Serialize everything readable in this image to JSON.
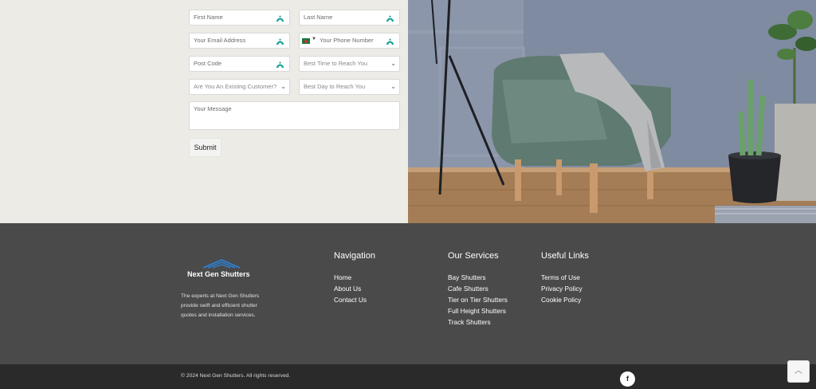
{
  "form": {
    "first_name_placeholder": "First Name",
    "last_name_placeholder": "Last Name",
    "email_placeholder": "Your Email Address",
    "phone_placeholder": "Your Phone Number",
    "postcode_placeholder": "Post Code",
    "best_time_placeholder": "Best Time to Reach You",
    "existing_customer_placeholder": "Are You An Existing Customer?",
    "best_day_placeholder": "Best Day to Reach You",
    "message_placeholder": "Your Message",
    "submit_label": "Submit"
  },
  "footer": {
    "brand_name": "Next Gen Shutters",
    "about_text": "The experts at Next Gen Shutters provide swift and efficient shutter quotes and installation services.",
    "navigation": {
      "title": "Navigation",
      "items": [
        "Home",
        "About Us",
        "Contact Us"
      ]
    },
    "services": {
      "title": "Our Services",
      "items": [
        "Bay Shutters",
        "Cafe Shutters",
        "Tier on Tier Shutters",
        "Full Height Shutters",
        "Track Shutters"
      ]
    },
    "useful_links": {
      "title": "Useful Links",
      "items": [
        "Terms of Use",
        "Privacy Policy",
        "Cookie Policy"
      ]
    },
    "copyright": "© 2024 Next Gen Shutters. All rights reserved.",
    "facebook_icon": "facebook-icon",
    "back_to_top_icon": "chevron-up-icon"
  },
  "colors": {
    "form_bg": "#ecebe6",
    "footer_bg": "#4a4a4a",
    "bottom_bar_bg": "#2a2a2a",
    "password_manager_icon": "#1aa39b",
    "logo_blue": "#2f7fd0"
  }
}
